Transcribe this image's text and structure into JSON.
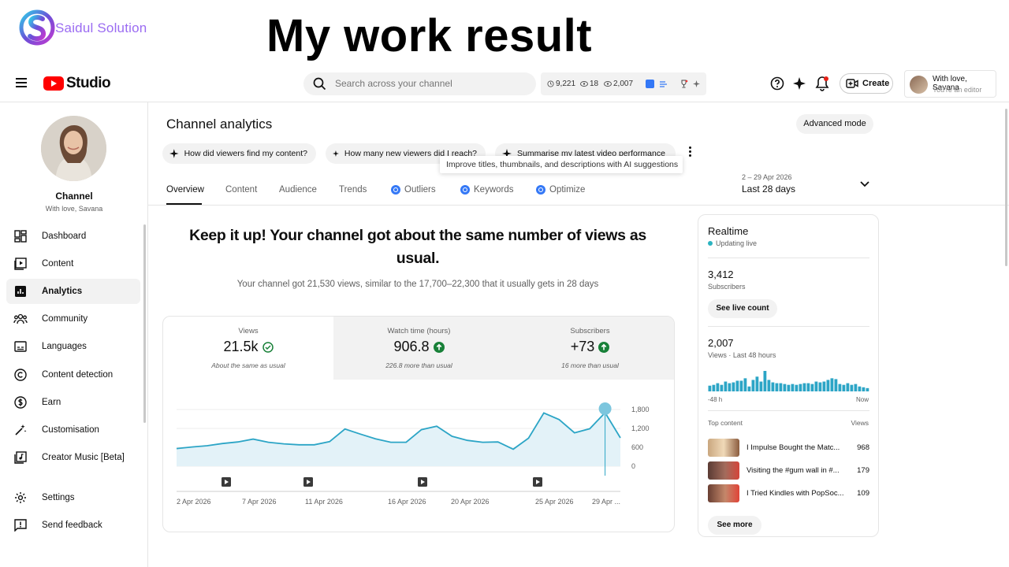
{
  "banner": {
    "brand_name": "Saidul Solution",
    "title": "My work result"
  },
  "topbar": {
    "studio_label": "Studio",
    "search_placeholder": "Search across your channel",
    "stats": {
      "a": "9,221",
      "b": "18",
      "c": "2,007"
    },
    "create_label": "Create",
    "account_name": "With love, Savana",
    "account_role": "You're an editor"
  },
  "sidebar": {
    "channel_title": "Channel",
    "channel_name": "With love, Savana",
    "items": [
      {
        "label": "Dashboard",
        "icon": "dashboard-icon"
      },
      {
        "label": "Content",
        "icon": "content-icon"
      },
      {
        "label": "Analytics",
        "icon": "analytics-icon",
        "active": true
      },
      {
        "label": "Community",
        "icon": "community-icon"
      },
      {
        "label": "Languages",
        "icon": "languages-icon"
      },
      {
        "label": "Content detection",
        "icon": "copyright-icon"
      },
      {
        "label": "Earn",
        "icon": "dollar-icon"
      },
      {
        "label": "Customisation",
        "icon": "wand-icon"
      },
      {
        "label": "Creator Music [Beta]",
        "icon": "music-icon"
      },
      {
        "label": "Settings",
        "icon": "gear-icon"
      },
      {
        "label": "Send feedback",
        "icon": "feedback-icon"
      }
    ]
  },
  "main": {
    "page_title": "Channel analytics",
    "advanced_mode": "Advanced mode",
    "chips": [
      "How did viewers find my content?",
      "How many new viewers did I reach?",
      "Summarise my latest video performance"
    ],
    "tooltip": "Improve titles, thumbnails, and descriptions with AI suggestions",
    "tabs": [
      "Overview",
      "Content",
      "Audience",
      "Trends",
      "Outliers",
      "Keywords",
      "Optimize"
    ],
    "date_range_small": "2 – 29 Apr 2026",
    "date_range_big": "Last 28 days",
    "headline": "Keep it up! Your channel got about the same number of views as usual.",
    "headline_sub": "Your channel got 21,530 views, similar to the 17,700–22,300 that it usually gets in 28 days",
    "metrics": [
      {
        "label": "Views",
        "value": "21.5k",
        "note": "About the same as usual",
        "status": "same"
      },
      {
        "label": "Watch time (hours)",
        "value": "906.8",
        "note": "226.8 more than usual",
        "status": "up"
      },
      {
        "label": "Subscribers",
        "value": "+73",
        "note": "16 more than usual",
        "status": "up"
      }
    ],
    "colors": {
      "line": "#2ca5c6",
      "fill": "#e3f2f8",
      "up": "#188038"
    }
  },
  "chart_data": {
    "type": "area",
    "x_ticks": [
      "2 Apr 2026",
      "7 Apr 2026",
      "11 Apr 2026",
      "16 Apr 2026",
      "20 Apr 2026",
      "25 Apr 2026",
      "29 Apr ..."
    ],
    "y_ticks": [
      "0",
      "600",
      "1,200",
      "1,800"
    ],
    "ylim": [
      0,
      1800
    ],
    "series": [
      {
        "values": [
          560,
          610,
          650,
          720,
          770,
          860,
          760,
          710,
          680,
          680,
          780,
          1180,
          1020,
          870,
          760,
          760,
          1160,
          1270,
          950,
          820,
          760,
          770,
          540,
          890,
          1690,
          1480,
          1060,
          1190,
          1700,
          900
        ]
      }
    ]
  },
  "realtime": {
    "title": "Realtime",
    "live": "Updating live",
    "subscribers_value": "3,412",
    "subscribers_label": "Subscribers",
    "see_live": "See live count",
    "views_value": "2,007",
    "views_label": "Views · Last 48 hours",
    "axis_left": "-48 h",
    "axis_right": "Now",
    "bars": [
      7,
      8,
      10,
      8,
      12,
      10,
      11,
      13,
      13,
      16,
      6,
      14,
      18,
      12,
      25,
      14,
      11,
      10,
      10,
      9,
      8,
      9,
      8,
      9,
      10,
      10,
      9,
      12,
      11,
      12,
      14,
      16,
      15,
      9,
      8,
      10,
      8,
      9,
      6,
      5,
      4
    ],
    "top_content_label": "Top content",
    "views_col_label": "Views",
    "top": [
      {
        "title": "I Impulse Bought the Matc...",
        "views": "968"
      },
      {
        "title": "Visiting the #gum wall in #...",
        "views": "179"
      },
      {
        "title": "I Tried Kindles with PopSoc...",
        "views": "109"
      }
    ],
    "see_more": "See more"
  }
}
